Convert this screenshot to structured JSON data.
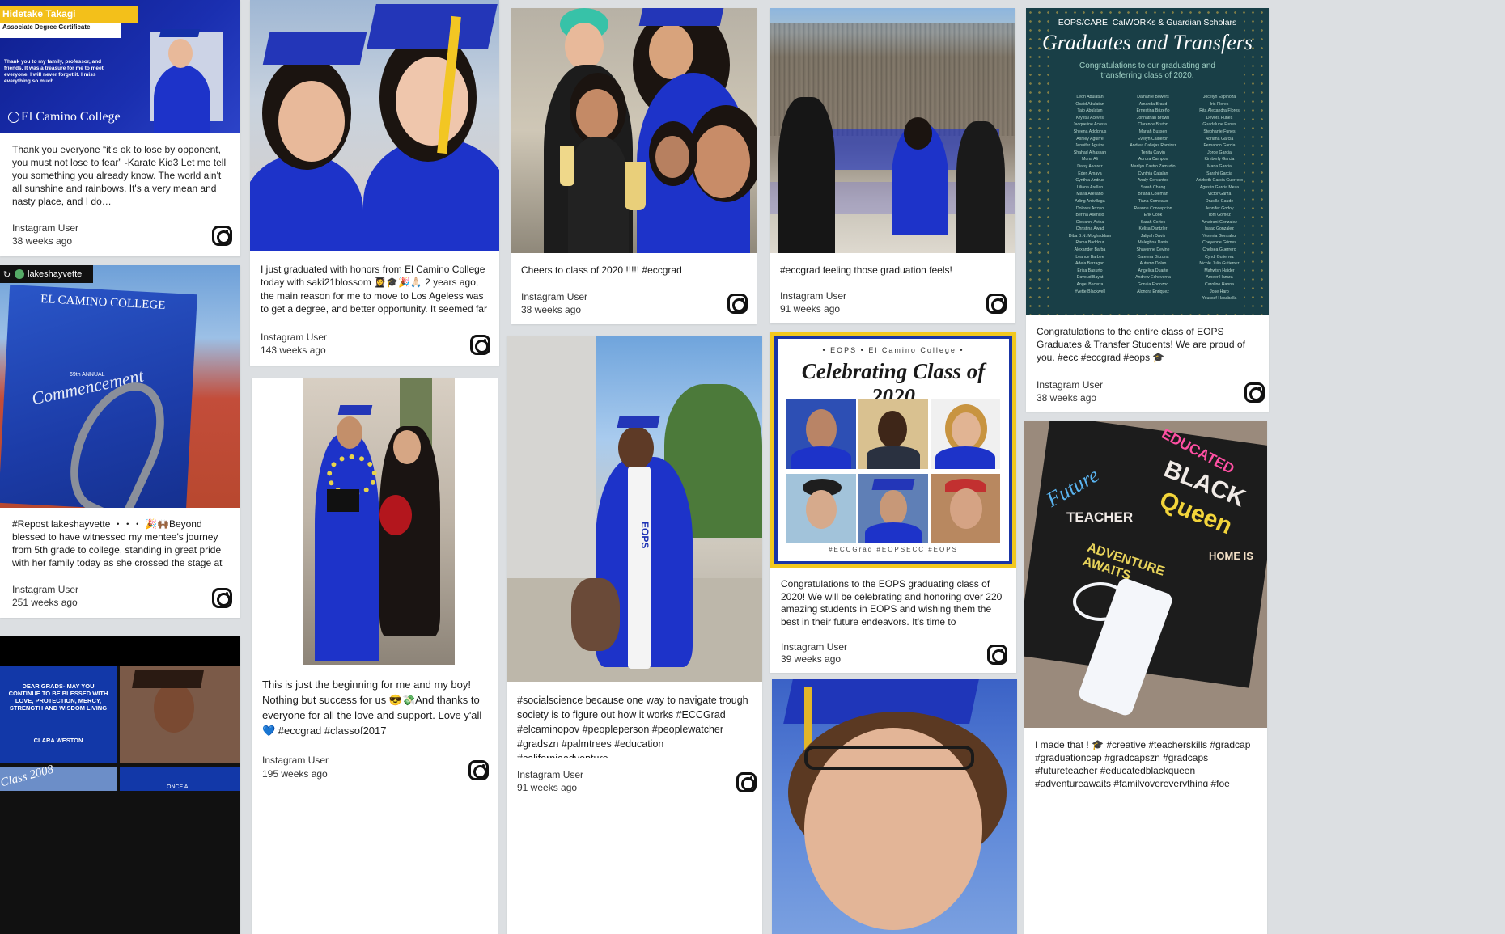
{
  "posts": [
    {
      "col": 1,
      "banner_name": "Hidetake Takagi",
      "banner_sub": "Associate Degree Certificate",
      "banner_quote": "Thank you to my family, professor, and friends. It was a treasure for me to meet everyone. I will never forget it. I miss everything so much...",
      "banner_college": "El Camino College",
      "text": "Thank you everyone “it’s ok to lose by opponent, you must not lose to fear” -Karate Kid3 Let me tell you something you already know. The world ain't all sunshine and rainbows. It's a very mean and nasty place, and I do…",
      "user": "Instagram User",
      "ago": "38 weeks ago"
    },
    {
      "col": 1,
      "repost_handle": "lakeshayvette",
      "book_title": "EL CAMINO COLLEGE",
      "book_annual": "69th ANNUAL",
      "book_script": "Commencement",
      "text": "#Repost lakeshayvette ・・・ 🎉🙌🏾Beyond blessed to have witnessed my mentee's journey from 5th grade to college, standing in great pride with her family today as she crossed the stage at ECC, accepting her degree + gr…",
      "user": "Instagram User",
      "ago": "251 weeks ago"
    },
    {
      "col": 1,
      "dear_grads": "DEAR GRADS- MAY YOU CONTINUE TO BE BLESSED WITH LOVE, PROTECTION, MERCY, STRENGTH AND WISDOM LIVING",
      "signature": "CLARA WESTON",
      "corner_text": "Class 2008",
      "once_text": "ONCE A"
    },
    {
      "col": 2,
      "text": "I just graduated with honors from El Camino College today with saki21blossom 👩‍🎓🎓🎉🙏🏻 2 years ago, the main reason for me to move to Los Ageless was to get a degree, and better opportunity. It seemed far away at…",
      "user": "Instagram User",
      "ago": "143 weeks ago"
    },
    {
      "col": 2,
      "text": "This is just the beginning for me and my boy! Nothing but success for us 😎💸And thanks to everyone for all the love and support. Love y'all 💙 #eccgrad #classof2017",
      "user": "Instagram User",
      "ago": "195 weeks ago"
    },
    {
      "col": 3,
      "text": "Cheers to class of 2020 !!!!! #eccgrad",
      "user": "Instagram User",
      "ago": "38 weeks ago"
    },
    {
      "col": 3,
      "text": "#socialscience because one way to navigate trough society is to figure out how it works #ECCGrad #elcaminopov #peopleperson #peoplewatcher #gradszn #palmtrees #education #californiaadventure",
      "user": "Instagram User",
      "ago": "91 weeks ago",
      "stole_text": "EOPS"
    },
    {
      "col": 4,
      "text": "#eccgrad feeling those graduation feels!",
      "user": "Instagram User",
      "ago": "91 weeks ago"
    },
    {
      "col": 4,
      "flyer_header": "• EOPS • El Camino College •",
      "flyer_title": "Celebrating Class of 2020",
      "flyer_tags": "#ECCGrad #EOPSECC #EOPS",
      "text": "Congratulations to the EOPS graduating class of 2020! We will be celebrating and honoring over 220 amazing students in EOPS and wishing them the best in their future endeavors. It's time to celebrate…",
      "user": "Instagram User",
      "ago": "39 weeks ago"
    },
    {
      "col": 5,
      "poster_top": "EOPS/CARE, CalWORKs & Guardian Scholars",
      "poster_title": "Graduates and Transfers",
      "poster_sub": "Congratulations to our graduating and transferring class of 2020.",
      "text": "Congratulations to the entire class of EOPS Graduates & Transfer Students! We are proud of you. #ecc #eccgrad #eops 🎓",
      "user": "Instagram User",
      "ago": "38 weeks ago"
    },
    {
      "col": 5,
      "capword1": "EDUCATED",
      "capword2": "BLACK",
      "capword3": "Queen",
      "capword4": "Future",
      "capword5": "TEACHER",
      "capword6": "ADVENTURE AWAITS",
      "capword7": "HOME IS",
      "text": "I made that ! 🎓 #creative #teacherskills #gradcap #graduationcap #gradcapszn #gradcaps #futureteacher #educatedblackqueen #adventureawaits #familyovereverything #foe #thanksmom"
    }
  ],
  "poster_names": [
    [
      "Leon Abulatan",
      "Osaid Abulatan",
      "Taio Abulatan",
      "Krystal Aceves",
      "Jacqueline Acosta",
      "Sheena Adolphus",
      "Ashley Aguirre",
      "Jennifer Aguirre",
      "Shahad Alhassan",
      "Muna Ali",
      "Daisy Alvarez",
      "Eden Amaya",
      "Cynthia Andrus",
      "Liliana Arellan",
      "Maria Arellano",
      "Arling Arrivillaga",
      "Dolores Arroyo",
      "Bertha Asencio",
      "Giovanni Avina",
      "Christina Awad",
      "Diba B.N. Moghaddam",
      "Rama Baddour",
      "Alexander Barba",
      "Leahce Barbee",
      "Adela Barragan",
      "Erika Basurto",
      "Davoud Bayat",
      "Angel Becerra",
      "Yvette Blackwell"
    ],
    [
      "Dalhante Bowers",
      "Amanda Braud",
      "Ernestina Brizeño",
      "Johnathan Brown",
      "Clarence Bruton",
      "Mariah Bussen",
      "Evelyn Calderon",
      "Andrea Callejas Ramirez",
      "Tenita Calvin",
      "Aurora Campos",
      "Marilyn Castro Zamudio",
      "Cynthia Catalan",
      "Analy Cervantes",
      "Sarah Chang",
      "Briana Coleman",
      "Tiana Comeaux",
      "Reanne Concepcion",
      "Erik Cook",
      "Sarah Cortes",
      "Kelisa Dantzler",
      "Jaliyah Davis",
      "Maleghna Davis",
      "Shavonne Devine",
      "Catenna Dirzona",
      "Autumn Dolan",
      "Angelica Duarte",
      "Andrew Echeverria",
      "Gonzia Endozoo",
      "Alondra Enriquez"
    ],
    [
      "Jocelyn Espinoza",
      "Iris Flores",
      "Rita Alexandra Flores",
      "Devora Funes",
      "Guadalupe Funes",
      "Stephanie Funes",
      "Adriana Garcia",
      "Fernando Garcia",
      "Jorge Garcia",
      "Kimberly Garcia",
      "Maria Garcia",
      "Sarahi Garcia",
      "Arizbeth Garcia Guerrero",
      "Agustin Garcia Meza",
      "Victor Garza",
      "Drusilla Gaude",
      "Jennifer Godoy",
      "Toni Gomez",
      "Amairani Gonzalez",
      "Isaac Gonzalez",
      "Yesenia Gonzalez",
      "Cheyenne Grimes",
      "Chelsea Guerrero",
      "Cyndi Gutierrez",
      "Nicole Julia Gutierrez",
      "Mahwish Haider",
      "Ameer Hamza",
      "Caroline Hanna",
      "Jose Haro",
      "Youssef Hasaballa"
    ]
  ]
}
